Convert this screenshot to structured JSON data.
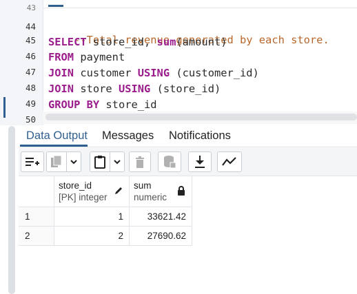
{
  "editor": {
    "partial_line_number": "43",
    "lines": [
      {
        "number": "44"
      },
      {
        "number": "45"
      },
      {
        "number": "46"
      },
      {
        "number": "47"
      },
      {
        "number": "48"
      },
      {
        "number": "49"
      },
      {
        "number": "50"
      }
    ],
    "code": {
      "comment": "--Total revenue generated by each store.",
      "select_kw": "SELECT",
      "select_rest_1": " store_id, ",
      "sum_fn": "sum",
      "select_rest_2": "(amount)",
      "from_kw": "FROM",
      "from_rest": " payment",
      "join1_kw": "JOIN",
      "join1_table": " customer ",
      "using1_kw": "USING",
      "using1_rest": " (customer_id)",
      "join2_kw": "JOIN",
      "join2_table": " store ",
      "using2_kw": "USING",
      "using2_rest": " (store_id)",
      "group_kw": "GROUP BY",
      "group_rest": " store_id"
    }
  },
  "tabs": [
    {
      "label": "Data Output",
      "active": true
    },
    {
      "label": "Messages",
      "active": false
    },
    {
      "label": "Notifications",
      "active": false
    }
  ],
  "toolbar": {
    "buttons": [
      {
        "icon": "add-row-icon"
      },
      {
        "icon": "copy-icon"
      },
      {
        "icon": "chevron-down-icon"
      },
      {
        "icon": "paste-icon"
      },
      {
        "icon": "chevron-down-icon"
      },
      {
        "icon": "delete-icon"
      },
      {
        "icon": "save-data-icon"
      },
      {
        "icon": "download-icon"
      },
      {
        "icon": "graph-icon"
      }
    ]
  },
  "grid": {
    "columns": [
      {
        "name": "store_id",
        "type": "[PK] integer",
        "icon": "pencil-icon"
      },
      {
        "name": "sum",
        "type": "numeric",
        "icon": "lock-icon"
      }
    ],
    "rows": [
      {
        "rownum": "1",
        "store_id": "1",
        "sum": "33621.42"
      },
      {
        "rownum": "2",
        "store_id": "2",
        "sum": "27690.62"
      }
    ]
  },
  "colors": {
    "accent": "#2f5f8f",
    "keyword": "#9b1c8d",
    "comment": "#b8672b"
  }
}
